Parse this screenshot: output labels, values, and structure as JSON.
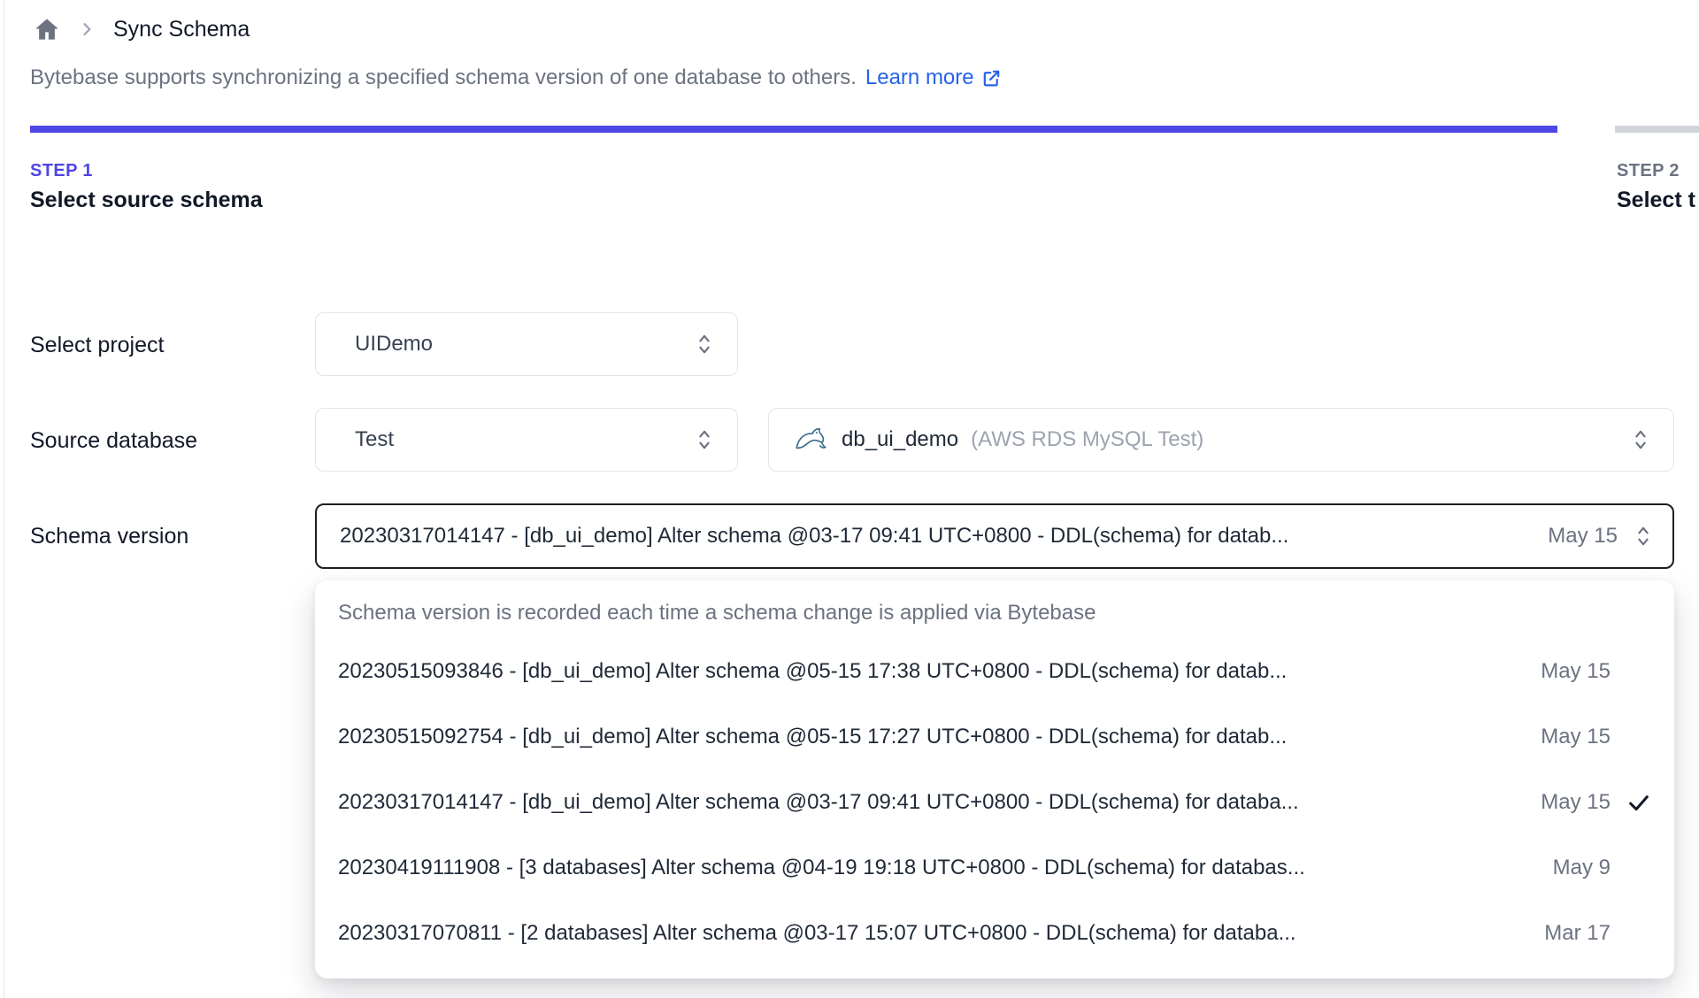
{
  "colors": {
    "accent": "#4f46e5",
    "inactive_bar": "#d1d5db",
    "link": "#2563eb",
    "muted_text": "#6b7280",
    "focused_border": "#1f1f23"
  },
  "breadcrumb": {
    "home_icon": "home-icon",
    "page_title": "Sync Schema"
  },
  "intro": {
    "text": "Bytebase supports synchronizing a specified schema version of one database to others.",
    "link_label": "Learn more",
    "link_icon": "external-link-icon"
  },
  "stepper": {
    "step1": {
      "label": "STEP 1",
      "title": "Select source schema"
    },
    "step2": {
      "label": "STEP 2",
      "title": "Select t"
    }
  },
  "form": {
    "project_label": "Select project",
    "project_value": "UIDemo",
    "source_db_label": "Source database",
    "environment_value": "Test",
    "database": {
      "engine_icon": "mysql-icon",
      "name": "db_ui_demo",
      "detail": "(AWS RDS MySQL Test)"
    },
    "schema_version_label": "Schema version",
    "schema_version": {
      "value": "20230317014147 - [db_ui_demo] Alter schema @03-17 09:41 UTC+0800 - DDL(schema) for datab...",
      "date": "May 15"
    }
  },
  "dropdown": {
    "note": "Schema version is recorded each time a schema change is applied via Bytebase",
    "options": [
      {
        "text": "20230515093846 - [db_ui_demo] Alter schema @05-15 17:38 UTC+0800 - DDL(schema) for datab...",
        "date": "May 15",
        "selected": false
      },
      {
        "text": "20230515092754 - [db_ui_demo] Alter schema @05-15 17:27 UTC+0800 - DDL(schema) for datab...",
        "date": "May 15",
        "selected": false
      },
      {
        "text": "20230317014147 - [db_ui_demo] Alter schema @03-17 09:41 UTC+0800 - DDL(schema) for databa...",
        "date": "May 15",
        "selected": true
      },
      {
        "text": "20230419111908 - [3 databases] Alter schema @04-19 19:18 UTC+0800 - DDL(schema) for databas...",
        "date": "May 9",
        "selected": false
      },
      {
        "text": "20230317070811 - [2 databases] Alter schema @03-17 15:07 UTC+0800 - DDL(schema) for databa...",
        "date": "Mar 17",
        "selected": false
      }
    ]
  }
}
